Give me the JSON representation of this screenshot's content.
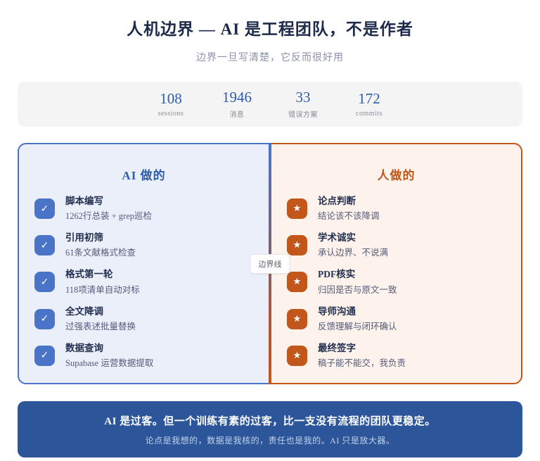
{
  "header": {
    "title": "人机边界 — AI 是工程团队，不是作者",
    "subtitle": "边界一旦写清楚，它反而很好用"
  },
  "stats": {
    "items": [
      {
        "value": "108",
        "label": "sessions"
      },
      {
        "value": "1946",
        "label": "消息"
      },
      {
        "value": "33",
        "label": "错误方案"
      },
      {
        "value": "172",
        "label": "commits"
      }
    ]
  },
  "icons": {
    "check": "✓",
    "star": "★"
  },
  "left_panel": {
    "heading": "AI 做的",
    "items": [
      {
        "title": "脚本编写",
        "desc": "1262行总装 + grep巡检"
      },
      {
        "title": "引用初筛",
        "desc": "61条文献格式检查"
      },
      {
        "title": "格式第一轮",
        "desc": "118项清单自动对标"
      },
      {
        "title": "全文降调",
        "desc": "过强表述批量替换"
      },
      {
        "title": "数据查询",
        "desc": "Supabase 运营数据提取"
      }
    ]
  },
  "right_panel": {
    "heading": "人做的",
    "items": [
      {
        "title": "论点判断",
        "desc": "结论该不该降调"
      },
      {
        "title": "学术诚实",
        "desc": "承认边界、不说满"
      },
      {
        "title": "PDF核实",
        "desc": "归因是否与原文一致"
      },
      {
        "title": "导师沟通",
        "desc": "反馈理解与闭环确认"
      },
      {
        "title": "最终签字",
        "desc": "稿子能不能交，我负责"
      }
    ]
  },
  "divider": {
    "label": "边界线"
  },
  "footer": {
    "line1": "AI 是过客。但一个训练有素的过客，比一支没有流程的团队更稳定。",
    "line2": "论点是我想的，数据是我核的，责任也是我的。AI 只是放大器。"
  },
  "colors": {
    "accent_blue": "#4a74c8",
    "accent_orange": "#c2571b",
    "heading_blue": "#2e5ca8",
    "banner_blue": "#2c5699",
    "left_bg": "#eaeffa",
    "right_bg": "#fdf2ec"
  }
}
